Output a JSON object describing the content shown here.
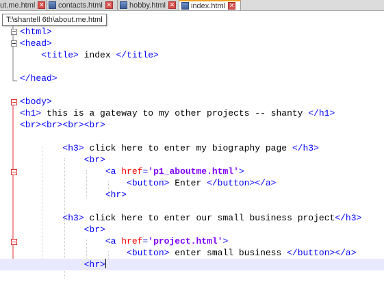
{
  "tabs": [
    {
      "label": "ut.me.html",
      "close_icon": "✕"
    },
    {
      "label": "contacts.html",
      "close_icon": "✕"
    },
    {
      "label": "hobby.html",
      "close_icon": "✕"
    },
    {
      "label": "index.html",
      "close_icon": "✕",
      "active": true
    }
  ],
  "tooltip": "T:\\shantell 6th\\about.me.html",
  "colors": {
    "tag": "#0000ff",
    "attribute": "#ff0000",
    "attribute_value": "#8000ff",
    "text": "#000000",
    "current_line": "#e8e8ff",
    "fold_marker_active": "#e03030"
  },
  "code": {
    "html_open": "<html>",
    "head_open": "<head>",
    "title_open": "<title>",
    "title_text": " index ",
    "title_close": "</title>",
    "head_close": "</head>",
    "body_open": "<body>",
    "h1_open": "<h1>",
    "h1_text": " this is a gateway to my other projects -- shanty ",
    "h1_close": "</h1>",
    "br4": "<br><br><br><br>",
    "h3_open": "<h3>",
    "h3a_text": " click here to enter my biography page ",
    "h3_close": "</h3>",
    "br": "<br>",
    "a_open_start": "<a ",
    "href_attr": "href",
    "equals": "=",
    "href_a": "'p1_aboutme.html'",
    "tag_end": ">",
    "button_open": "<button>",
    "button_a_text": " Enter ",
    "button_close": "</button>",
    "a_close": "</a>",
    "hr": "<hr>",
    "h3b_text": " click here to enter our small business project",
    "href_b": "'project.html'",
    "button_b_text": " enter small business "
  }
}
